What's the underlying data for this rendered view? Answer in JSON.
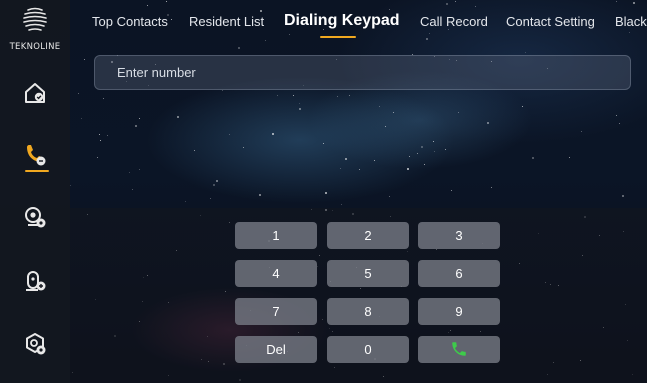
{
  "brand": {
    "logo_text": "TEKNOLINE"
  },
  "sidebar": {
    "items": [
      {
        "icon": "home-icon",
        "active": false
      },
      {
        "icon": "phone-icon",
        "active": true
      },
      {
        "icon": "camera-icon",
        "active": false
      },
      {
        "icon": "door-unlock-icon",
        "active": false
      },
      {
        "icon": "settings-icon",
        "active": false
      }
    ]
  },
  "tabs": [
    {
      "label": "Top Contacts",
      "active": false
    },
    {
      "label": "Resident List",
      "active": false
    },
    {
      "label": "Dialing Keypad",
      "active": true
    },
    {
      "label": "Call Record",
      "active": false
    },
    {
      "label": "Contact Setting",
      "active": false
    },
    {
      "label": "Black",
      "active": false
    }
  ],
  "number_input": {
    "placeholder": "Enter number",
    "value": ""
  },
  "keypad": {
    "keys": [
      "1",
      "2",
      "3",
      "4",
      "5",
      "6",
      "7",
      "8",
      "9",
      "Del",
      "0"
    ],
    "call_icon": "phone-call-icon"
  },
  "colors": {
    "accent": "#f0a820",
    "call_green": "#3ecb4a",
    "key_bg": "#7a7e86",
    "sidebar_bg": "#14181f"
  }
}
